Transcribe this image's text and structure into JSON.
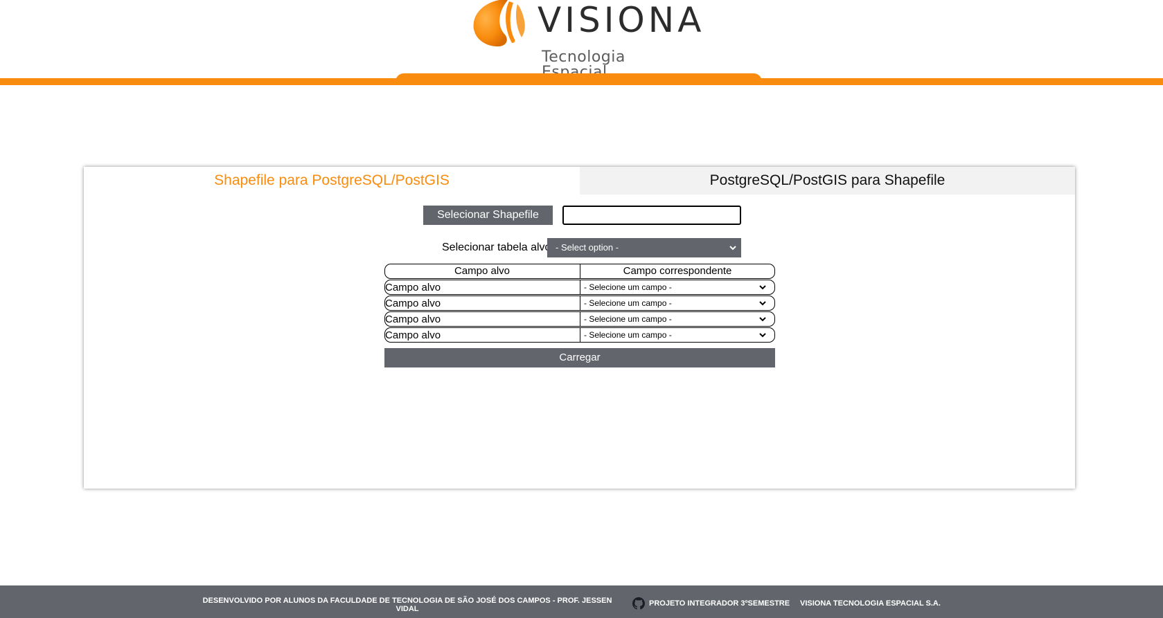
{
  "brand": {
    "name": "VISIONA",
    "tagline": "Tecnologia Espacial",
    "accent_color": "#f98c0e",
    "dark_color": "#62656b"
  },
  "tabs": [
    {
      "label": "Shapefile para PostgreSQL/PostGIS",
      "active": true
    },
    {
      "label": "PostgreSQL/PostGIS para Shapefile",
      "active": false
    }
  ],
  "form": {
    "select_shapefile_label": "Selecionar Shapefile",
    "file_input_value": "",
    "target_table_label": "Selecionar tabela alvo:",
    "target_table_selected": "- Select option -",
    "table_headers": [
      "Campo alvo",
      "Campo correspondente"
    ],
    "rows": [
      {
        "target": "Campo alvo",
        "match": "- Selecione um campo -"
      },
      {
        "target": "Campo alvo",
        "match": "- Selecione um campo -"
      },
      {
        "target": "Campo alvo",
        "match": "- Selecione um campo -"
      },
      {
        "target": "Campo alvo",
        "match": "- Selecione um campo -"
      }
    ],
    "load_button_label": "Carregar"
  },
  "footer": {
    "credits": "DESENVOLVIDO POR ALUNOS DA FACULDADE DE TECNOLOGIA DE SÃO JOSÉ DOS CAMPOS - PROF. JESSEN VIDAL",
    "project": "PROJETO INTEGRADOR 3ºSEMESTRE",
    "company": "VISIONA TECNOLOGIA ESPACIAL S.A.",
    "project_icon": "github-icon"
  }
}
